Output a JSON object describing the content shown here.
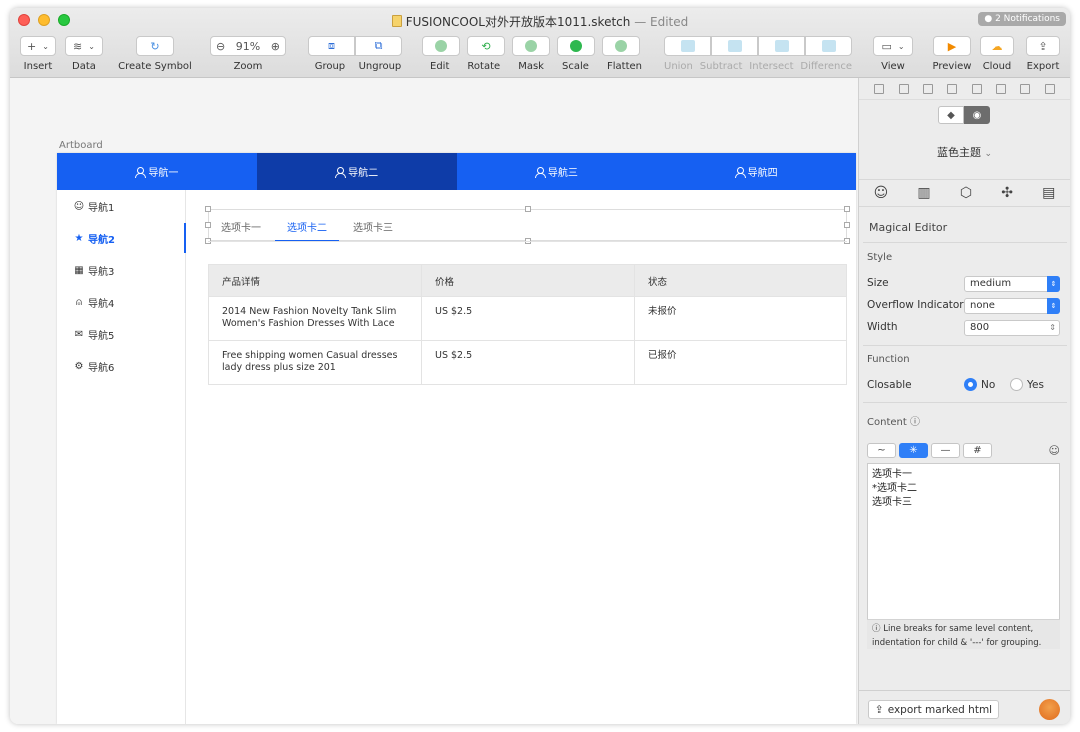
{
  "window": {
    "title": "FUSIONCOOL对外开放版本1011.sketch",
    "edited": "— Edited",
    "notifications": "● 2 Notifications"
  },
  "toolbar": {
    "insert": "Insert",
    "data": "Data",
    "create_symbol": "Create Symbol",
    "zoom": "Zoom",
    "zoom_value": "91%",
    "group": "Group",
    "ungroup": "Ungroup",
    "edit": "Edit",
    "rotate": "Rotate",
    "mask": "Mask",
    "scale": "Scale",
    "flatten": "Flatten",
    "union": "Union",
    "subtract": "Subtract",
    "intersect": "Intersect",
    "difference": "Difference",
    "view": "View",
    "preview": "Preview",
    "cloud": "Cloud",
    "export": "Export"
  },
  "canvas": {
    "artboard_label": "Artboard",
    "top_nav": [
      "导航一",
      "导航二",
      "导航三",
      "导航四"
    ],
    "side_nav": [
      {
        "icon": "smile-icon",
        "glyph": "☺",
        "label": "导航1"
      },
      {
        "icon": "star-icon",
        "glyph": "★",
        "label": "导航2"
      },
      {
        "icon": "calendar-icon",
        "glyph": "▦",
        "label": "导航3"
      },
      {
        "icon": "user-icon",
        "glyph": "⍝",
        "label": "导航4"
      },
      {
        "icon": "mail-icon",
        "glyph": "✉",
        "label": "导航5"
      },
      {
        "icon": "gear-icon",
        "glyph": "⚙",
        "label": "导航6"
      }
    ],
    "tabs": [
      "选项卡一",
      "选项卡二",
      "选项卡三"
    ],
    "table": {
      "headers": [
        "产品详情",
        "价格",
        "状态"
      ],
      "rows": [
        [
          "2014 New Fashion Novelty Tank Slim Women's Fashion Dresses With Lace",
          "US $2.5",
          "未报价"
        ],
        [
          "Free shipping women Casual dresses lady dress plus size 201",
          "US $2.5",
          "已报价"
        ]
      ]
    }
  },
  "inspector": {
    "theme": "蓝色主题",
    "panel_title": "Magical Editor",
    "style_section": "Style",
    "size_label": "Size",
    "size_value": "medium",
    "overflow_label": "Overflow Indicator",
    "overflow_value": "none",
    "width_label": "Width",
    "width_value": "800",
    "function_section": "Function",
    "closable_label": "Closable",
    "closable_no": "No",
    "closable_yes": "Yes",
    "content_section": "Content",
    "format_buttons": [
      "~",
      "✳",
      "—",
      "#"
    ],
    "content_lines": [
      "选项卡一",
      "*选项卡二",
      "选项卡三"
    ],
    "hint": "Line breaks for same level content, indentation for child & '---' for grouping.",
    "export_button": "export marked html"
  }
}
